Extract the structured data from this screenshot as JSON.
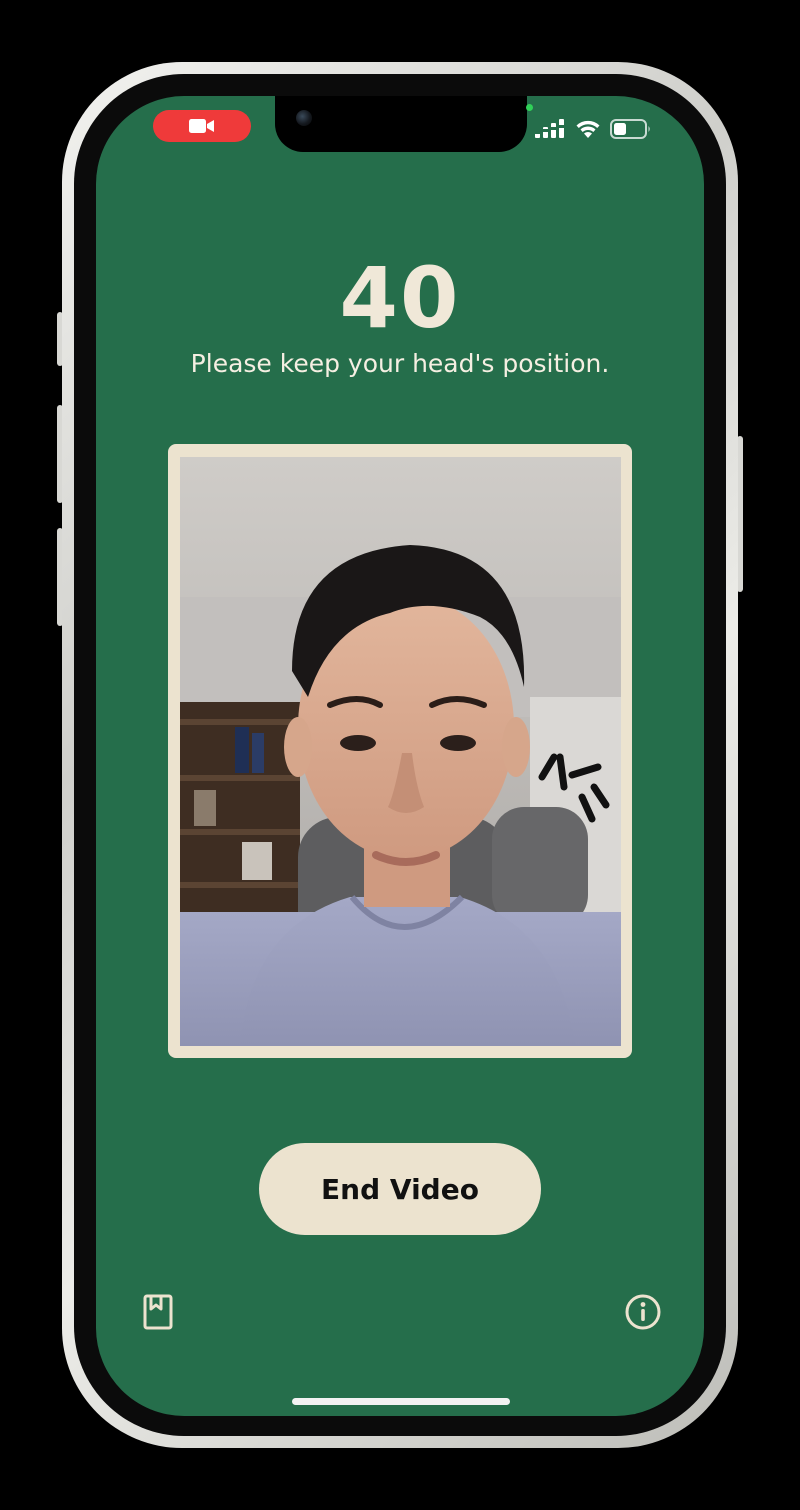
{
  "status_bar": {
    "recording_icon": "video-camera-icon",
    "signal_icon": "cellular-signal-icon",
    "wifi_icon": "wifi-icon",
    "battery_icon": "battery-icon",
    "recording_color": "#ef3a3a",
    "privacy_dot_color": "#30d158"
  },
  "countdown": {
    "value": "40"
  },
  "instruction": {
    "text": "Please keep your head's position."
  },
  "video": {
    "description_icon": "camera-preview"
  },
  "actions": {
    "end_video_label": "End Video"
  },
  "bottom_bar": {
    "left_icon": "bookmark-book-icon",
    "right_icon": "info-icon"
  },
  "colors": {
    "background": "#256e4b",
    "accent_cream": "#ece3cf",
    "text_light": "#f5efe2"
  }
}
